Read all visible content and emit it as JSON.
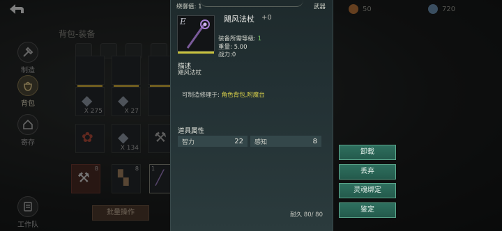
{
  "bag_title": "背包-装备",
  "nav": [
    {
      "label": "制造"
    },
    {
      "label": "背包"
    },
    {
      "label": "寄存"
    },
    {
      "label": "工作队列"
    }
  ],
  "slots": {
    "qty_275": "X 275",
    "qty_27": "X 27",
    "qty_134": "X 134",
    "corner_8a": "8",
    "corner_8b": "8",
    "corner_1": "1"
  },
  "bulk_button": "批量操作",
  "currency": [
    {
      "value": "50",
      "color": "#b8743a"
    },
    {
      "value": "720",
      "color": "#6a8fb0"
    }
  ],
  "detail": {
    "header_left": "绕御值: 1",
    "header_right": "武器",
    "grade": "E",
    "item_name": "飓风法杖",
    "enhance": "+0",
    "req_label": "装备所需等级: ",
    "req_value": "1",
    "weight": "重量:   5.00",
    "power": "战力:0",
    "desc_title": "描述",
    "desc_text": "飓风法杖",
    "repair_label": "可制造修理于: ",
    "repair_places": "角色背包,附魔台",
    "props_title": "道具属性",
    "attrs": [
      {
        "name": "智力",
        "value": "22"
      },
      {
        "name": "感知",
        "value": "8"
      }
    ],
    "durability": "耐久 80/ 80"
  },
  "actions": [
    "卸载",
    "丢弃",
    "灵魂绑定",
    "鉴定"
  ],
  "colors": {
    "action_green": "#2e6f5e",
    "rarity_yellow": "#c9c23d",
    "stat_green": "#7fd06a",
    "repair_yellow": "#d7cf4a"
  }
}
